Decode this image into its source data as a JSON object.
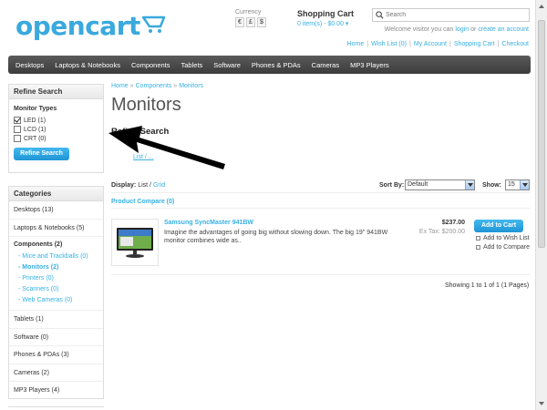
{
  "header": {
    "logo_text": "opencart",
    "currency_label": "Currency",
    "currencies": [
      "€",
      "£",
      "$"
    ],
    "cart_title": "Shopping Cart",
    "cart_summary": "0 item(s) - $0.00",
    "search_placeholder": "Search",
    "welcome_prefix": "Welcome visitor you can",
    "login": "login",
    "or": "or",
    "create_account": "create an account",
    "links": [
      "Home",
      "Wish List (0)",
      "My Account",
      "Shopping Cart",
      "Checkout"
    ]
  },
  "menu": [
    "Desktops",
    "Laptops & Notebooks",
    "Components",
    "Tablets",
    "Software",
    "Phones & PDAs",
    "Cameras",
    "MP3 Players"
  ],
  "refine_box": {
    "title": "Refine Search",
    "group": "Monitor Types",
    "options": [
      {
        "label": "LED (1)",
        "checked": true
      },
      {
        "label": "LCD (1)",
        "checked": false
      },
      {
        "label": "CRT (0)",
        "checked": false
      }
    ],
    "button": "Refine Search"
  },
  "categories": {
    "title": "Categories",
    "top": [
      "Desktops (13)",
      "Laptops & Notebooks (5)"
    ],
    "current": "Components (2)",
    "subs": [
      "- Mice and Trackballs (0)",
      "- Monitors (2)",
      "- Printers (0)",
      "- Scanners (0)",
      "- Web Cameras (0)"
    ],
    "rest": [
      "Tablets (1)",
      "Software (0)",
      "Phones & PDAs (3)",
      "Cameras (2)",
      "MP3 Players (4)"
    ]
  },
  "content": {
    "breadcrumb": [
      "Home",
      "Components",
      "Monitors"
    ],
    "title": "Monitors",
    "refine_heading": "Refine Search",
    "hidden_link": "List / ...",
    "display_label": "Display:",
    "display_list": "List",
    "display_sep": "/",
    "display_grid": "Grid",
    "sort_label": "Sort By:",
    "sort_value": "Default",
    "show_label": "Show:",
    "show_value": "15",
    "compare": "Product Compare (0)",
    "pagination": "Showing 1 to 1 of 1 (1 Pages)"
  },
  "product": {
    "name": "Samsung SyncMaster 941BW",
    "description": "Imagine the advantages of going big without slowing down. The big 19\" 941BW monitor combines wide as..",
    "price": "$237.00",
    "ex_tax": "Ex Tax: $200.00",
    "add_to_cart": "Add to Cart",
    "wish": "Add to Wish List",
    "compare": "Add to Compare"
  },
  "colors": {
    "accent": "#38b0e3",
    "menu": "#4a4a4a",
    "button": "#1f95d6"
  }
}
